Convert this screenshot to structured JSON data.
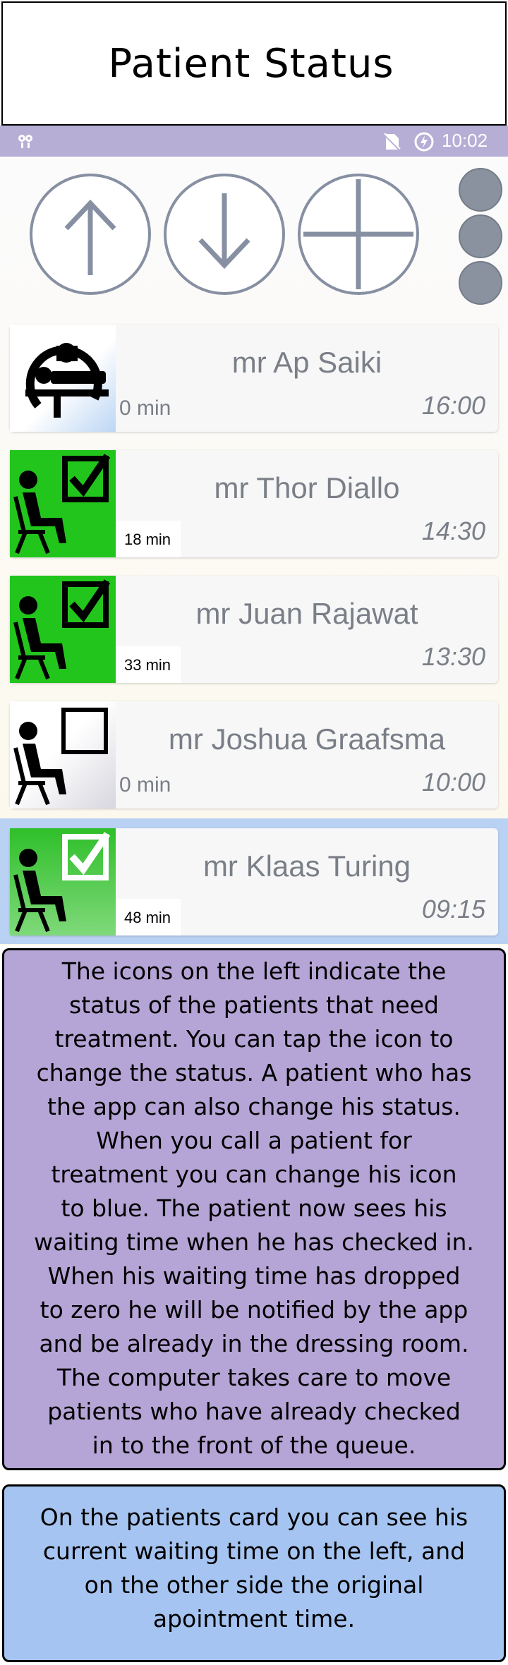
{
  "page_title": "Patient Status",
  "statusbar": {
    "time": "10:02",
    "left_icon": "android-debug-icon",
    "sim_icon": "no-sim-icon",
    "battery_icon": "battery-charging-icon"
  },
  "toolbar": {
    "up_icon": "arrow-up-icon",
    "down_icon": "arrow-down-icon",
    "add_icon": "plus-icon",
    "menu_dots": 3
  },
  "patients": [
    {
      "name": "mr Ap Saiki",
      "wait": "0 min",
      "time": "16:00",
      "status": "in-treatment",
      "icon": "scanner-icon"
    },
    {
      "name": "mr Thor Diallo",
      "wait": "18 min",
      "time": "14:30",
      "status": "checked-in",
      "icon": "checked-in-icon"
    },
    {
      "name": "mr Juan Rajawat",
      "wait": "33 min",
      "time": "13:30",
      "status": "checked-in",
      "icon": "checked-in-icon"
    },
    {
      "name": "mr Joshua Graafsma",
      "wait": "0 min",
      "time": "10:00",
      "status": "not-checked-in",
      "icon": "waiting-icon"
    },
    {
      "name": "mr Klaas Turing",
      "wait": "48 min",
      "time": "09:15",
      "status": "checked-in-selected",
      "icon": "checked-in-icon"
    }
  ],
  "notes": {
    "note1": [
      "The icons on the left indicate the",
      "status of the patients that need",
      "treatment. You can tap the icon to",
      "change the status. A patient who has",
      "the app can also change his status.",
      "When you call a patient for",
      "treatment you can change his icon",
      "to blue. The patient now sees his",
      "waiting time when he has checked in.",
      "When his waiting time has dropped",
      "to zero he will be notified by the app",
      "and be already in the dressing room.",
      "The computer takes care to move",
      "patients who have already checked",
      "in to the front of the queue."
    ],
    "note2": [
      "On the patients card you can see his",
      "current waiting time on the left, and",
      "on the other side the original",
      "apointment time."
    ]
  },
  "colors": {
    "statusbar": "#b7aed6",
    "checked_green": "#22c51c",
    "selected_row": "#b9d2f4",
    "note1_bg": "#b5a5d6",
    "note2_bg": "#a6c4f1"
  }
}
